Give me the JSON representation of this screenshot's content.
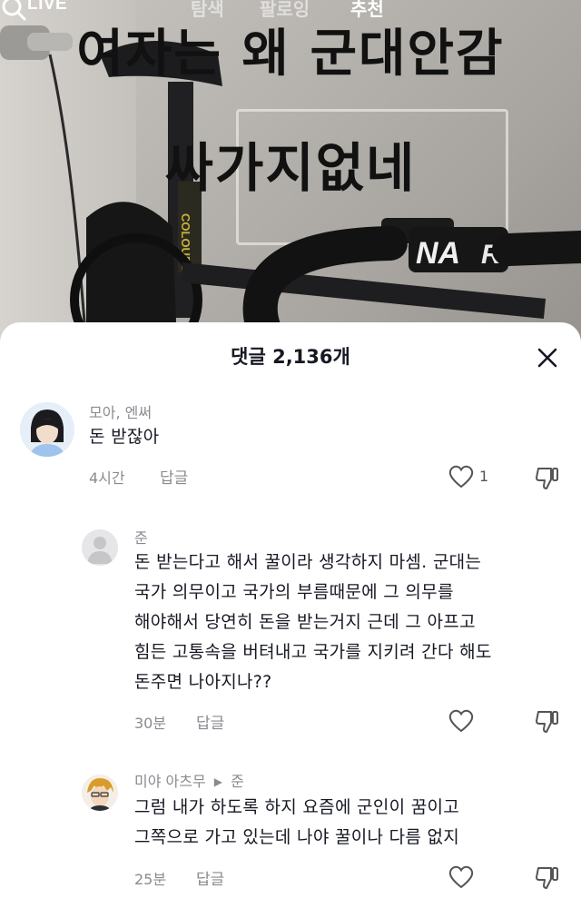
{
  "topnav": {
    "live": "LIVE",
    "tabs": [
      "탐색",
      "팔로잉",
      "추천"
    ],
    "active_tab": 2
  },
  "overlay": {
    "line1": "여자는 왜 군대안감",
    "line2": "싸가지없네"
  },
  "sheet": {
    "title": "댓글 2,136개"
  },
  "comments": [
    {
      "author": "모아, 엔써",
      "text": "돈 받잖아",
      "time": "4시간",
      "reply_label": "답글",
      "likes": "1"
    },
    {
      "author": "준",
      "text_lines": [
        "돈 받는다고 해서 꿀이라 생각하지 마셈. 군대는",
        "국가 의무이고 국가의 부름때문에 그 의무를",
        "해야해서 당연히 돈을 받는거지 근데 그 아프고",
        "힘든 고통속을 버텨내고 국가를 지키려 간다 해도",
        "돈주면 나아지나??"
      ],
      "time": "30분",
      "reply_label": "답글"
    },
    {
      "author": "미야 아츠무",
      "reply_to": "준",
      "text_lines": [
        "그럼 내가 하도록 하지 요즘에 군인이 꿈이고",
        "그쪽으로 가고 있는데 나야 꿀이나 다름 없지"
      ],
      "time": "25분",
      "reply_label": "답글"
    }
  ],
  "colors": {
    "secondary_text": "#8a8b91",
    "primary_text": "#161823"
  }
}
